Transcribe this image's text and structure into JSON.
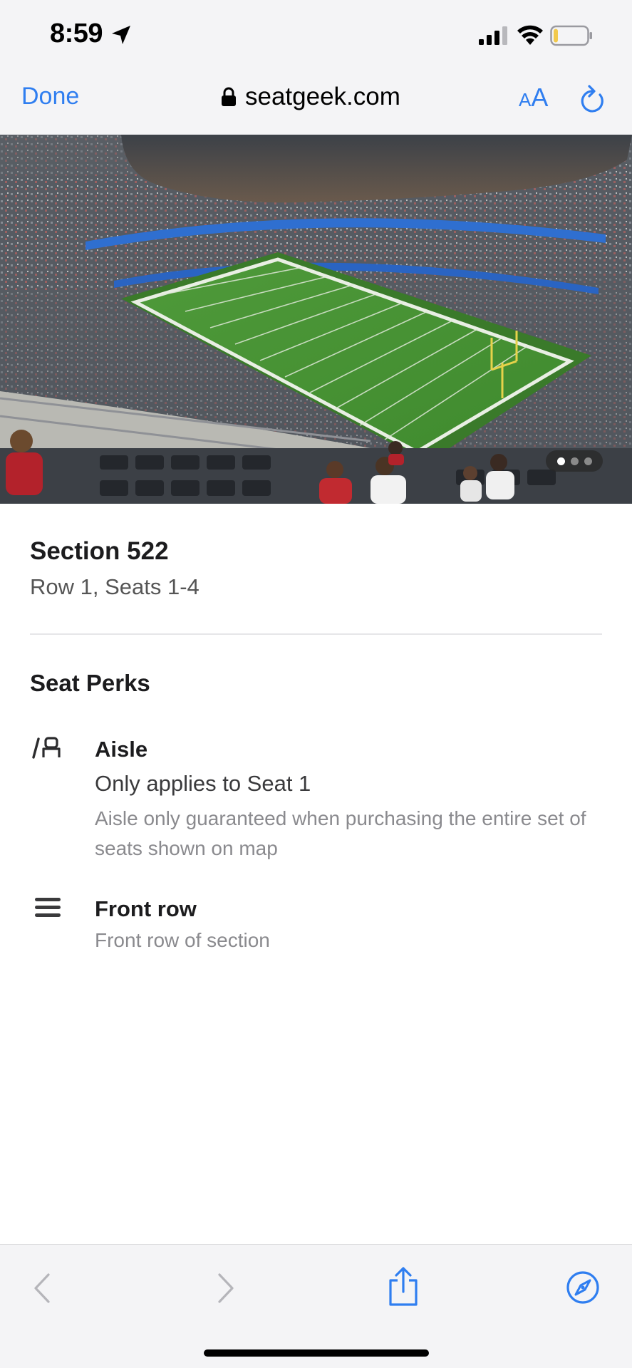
{
  "status_bar": {
    "time": "8:59",
    "icons": [
      "location-arrow-icon",
      "signal-icon",
      "wifi-icon",
      "battery-icon"
    ]
  },
  "browser": {
    "done_label": "Done",
    "url": "seatgeek.com",
    "text_size_label_small": "A",
    "text_size_label_big": "A",
    "accent_color": "#2f7ef0"
  },
  "photo": {
    "carousel_total": 3,
    "carousel_active": 1
  },
  "listing": {
    "section": "Section 522",
    "row_seats": "Row 1, Seats 1-4"
  },
  "perks": {
    "heading": "Seat Perks",
    "items": [
      {
        "icon": "aisle-seat-icon",
        "title": "Aisle",
        "subtitle": "Only applies to Seat 1",
        "note": "Aisle only guaranteed when purchasing the entire set of seats shown on map"
      },
      {
        "icon": "front-row-icon",
        "title": "Front row",
        "subtitle": "Front row of section"
      }
    ]
  },
  "toolbar": {
    "icons": [
      "back-chevron-icon",
      "forward-chevron-icon",
      "share-icon",
      "compass-icon"
    ]
  }
}
